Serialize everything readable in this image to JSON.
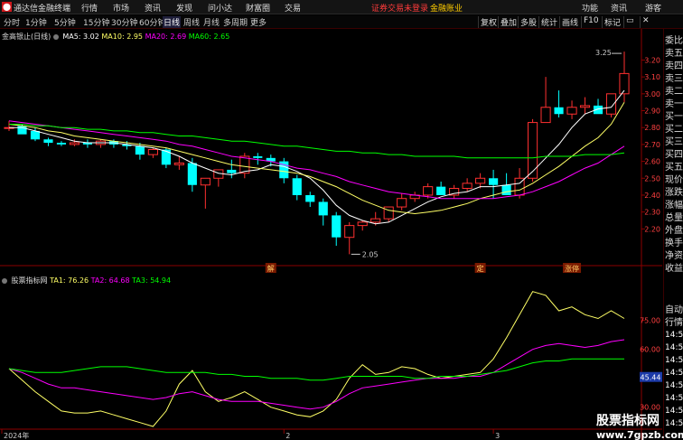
{
  "menubar": {
    "app_title": "通达信金融终端",
    "items": [
      "行情",
      "市场",
      "资讯",
      "发现",
      "问小达",
      "财富圈",
      "交易"
    ],
    "login_warning": "证券交易未登录",
    "login_extra": "金融账业",
    "right_items": [
      "功能",
      "资讯",
      "游客"
    ]
  },
  "toolbar": {
    "periods": [
      "分时",
      "1分钟",
      "5分钟",
      "15分钟",
      "30分钟",
      "60分钟",
      "日线",
      "周线",
      "月线",
      "多周期",
      "更多"
    ],
    "active_period": "日线",
    "tools": [
      "复权",
      "叠加",
      "多股",
      "统计",
      "画线",
      "F10",
      "标记"
    ]
  },
  "main_chart": {
    "title": "金高银止(日线)",
    "ma5_label": "MA5: 3.02",
    "ma10_label": "MA10: 2.95",
    "ma20_label": "MA20: 2.69",
    "ma60_label": "MA60: 2.65",
    "high_marker": "3.25",
    "low_marker": "2.05",
    "event_labels": [
      "解",
      "定",
      "涨停"
    ],
    "price_ticks": [
      "3.20",
      "3.10",
      "3.00",
      "2.90",
      "2.80",
      "2.70",
      "2.60",
      "2.50",
      "2.40",
      "2.30",
      "2.20"
    ]
  },
  "sub_chart": {
    "title": "股票指标网",
    "ta1_label": "TA1: 76.26",
    "ta2_label": "TA2: 64.68",
    "ta3_label": "TA3: 54.94",
    "value_ticks": [
      "75.00",
      "60.00",
      "45.00",
      "30.00"
    ],
    "current_badge": "45.44",
    "date_labels": [
      "2024年",
      "2",
      "3"
    ]
  },
  "side_panel": {
    "labels": [
      "委比",
      "卖五",
      "卖四",
      "卖三",
      "卖二",
      "卖一",
      "买一",
      "买二",
      "买三",
      "买四",
      "买五",
      "现价",
      "涨跌",
      "涨幅",
      "总量",
      "外盘",
      "换手",
      "净资",
      "收益",
      "自动",
      "行情"
    ],
    "times": [
      "14:56",
      "14:56",
      "14:56",
      "14:56",
      "14:56",
      "14:56",
      "14:56",
      "14:56"
    ]
  },
  "watermark": {
    "main": "股票指标网",
    "sub": "www.7gpzb.com"
  },
  "colors": {
    "up": "#ff3030",
    "down": "#00ffff",
    "ma5": "#ffffff",
    "ma10": "#ffff66",
    "ma20": "#ff00ff",
    "ma60": "#00ff00",
    "ta1": "#ffff66",
    "ta2": "#ff00ff",
    "ta3": "#00ff00"
  },
  "chart_data": [
    {
      "type": "candlestick",
      "title": "金高银止(日线)",
      "x_index": [
        0,
        1,
        2,
        3,
        4,
        5,
        6,
        7,
        8,
        9,
        10,
        11,
        12,
        13,
        14,
        15,
        16,
        17,
        18,
        19,
        20,
        21,
        22,
        23,
        24,
        25,
        26,
        27,
        28,
        29,
        30,
        31,
        32,
        33,
        34,
        35,
        36,
        37,
        38,
        39,
        40,
        41,
        42,
        43,
        44
      ],
      "open": [
        2.8,
        2.81,
        2.78,
        2.73,
        2.71,
        2.7,
        2.71,
        2.7,
        2.72,
        2.7,
        2.69,
        2.64,
        2.67,
        2.58,
        2.59,
        2.46,
        2.5,
        2.55,
        2.53,
        2.63,
        2.62,
        2.6,
        2.5,
        2.4,
        2.36,
        2.28,
        2.15,
        2.22,
        2.24,
        2.26,
        2.33,
        2.38,
        2.4,
        2.45,
        2.4,
        2.44,
        2.47,
        2.5,
        2.46,
        2.4,
        2.5,
        2.83,
        2.92,
        2.88,
        2.92,
        2.93,
        2.88,
        3.0
      ],
      "high": [
        2.84,
        2.82,
        2.8,
        2.74,
        2.72,
        2.73,
        2.73,
        2.73,
        2.73,
        2.72,
        2.71,
        2.68,
        2.68,
        2.63,
        2.62,
        2.5,
        2.55,
        2.61,
        2.65,
        2.65,
        2.64,
        2.62,
        2.52,
        2.42,
        2.38,
        2.3,
        2.24,
        2.25,
        2.3,
        2.33,
        2.41,
        2.42,
        2.47,
        2.48,
        2.46,
        2.5,
        2.53,
        2.55,
        2.53,
        2.56,
        2.85,
        3.1,
        3.02,
        2.96,
        2.98,
        2.97,
        2.96,
        3.25
      ],
      "low": [
        2.78,
        2.78,
        2.72,
        2.69,
        2.69,
        2.69,
        2.68,
        2.68,
        2.68,
        2.67,
        2.61,
        2.62,
        2.56,
        2.55,
        2.42,
        2.32,
        2.45,
        2.5,
        2.5,
        2.58,
        2.57,
        2.47,
        2.37,
        2.33,
        2.22,
        2.1,
        2.05,
        2.19,
        2.22,
        2.24,
        2.31,
        2.36,
        2.38,
        2.4,
        2.38,
        2.42,
        2.44,
        2.38,
        2.4,
        2.38,
        2.48,
        2.86,
        2.86,
        2.85,
        2.88,
        2.9,
        2.86,
        2.95
      ],
      "close": [
        2.8,
        2.76,
        2.73,
        2.71,
        2.7,
        2.71,
        2.7,
        2.72,
        2.7,
        2.69,
        2.64,
        2.67,
        2.58,
        2.59,
        2.46,
        2.5,
        2.55,
        2.53,
        2.63,
        2.62,
        2.6,
        2.5,
        2.4,
        2.36,
        2.28,
        2.15,
        2.22,
        2.24,
        2.26,
        2.33,
        2.38,
        2.4,
        2.45,
        2.4,
        2.44,
        2.47,
        2.5,
        2.46,
        2.4,
        2.5,
        2.83,
        2.92,
        2.88,
        2.92,
        2.93,
        2.88,
        3.0,
        3.12
      ],
      "ma5": [
        2.8,
        2.8,
        2.78,
        2.76,
        2.74,
        2.72,
        2.71,
        2.71,
        2.71,
        2.7,
        2.69,
        2.68,
        2.66,
        2.63,
        2.59,
        2.56,
        2.53,
        2.52,
        2.54,
        2.55,
        2.58,
        2.57,
        2.54,
        2.5,
        2.43,
        2.34,
        2.28,
        2.25,
        2.23,
        2.24,
        2.28,
        2.32,
        2.36,
        2.39,
        2.41,
        2.42,
        2.45,
        2.45,
        2.46,
        2.47,
        2.54,
        2.62,
        2.7,
        2.8,
        2.88,
        2.91,
        2.92,
        3.02
      ],
      "ma10": [
        2.82,
        2.81,
        2.8,
        2.78,
        2.77,
        2.75,
        2.74,
        2.73,
        2.72,
        2.71,
        2.7,
        2.69,
        2.68,
        2.66,
        2.64,
        2.62,
        2.6,
        2.58,
        2.57,
        2.56,
        2.55,
        2.54,
        2.53,
        2.51,
        2.48,
        2.45,
        2.41,
        2.37,
        2.34,
        2.31,
        2.3,
        2.29,
        2.3,
        2.31,
        2.33,
        2.35,
        2.38,
        2.4,
        2.42,
        2.43,
        2.47,
        2.52,
        2.57,
        2.63,
        2.69,
        2.74,
        2.82,
        2.95
      ],
      "ma20": [
        2.84,
        2.83,
        2.82,
        2.81,
        2.8,
        2.79,
        2.78,
        2.77,
        2.76,
        2.75,
        2.74,
        2.73,
        2.72,
        2.7,
        2.69,
        2.67,
        2.65,
        2.63,
        2.62,
        2.61,
        2.6,
        2.58,
        2.56,
        2.55,
        2.53,
        2.51,
        2.48,
        2.46,
        2.44,
        2.42,
        2.41,
        2.4,
        2.39,
        2.38,
        2.38,
        2.38,
        2.38,
        2.38,
        2.39,
        2.4,
        2.42,
        2.45,
        2.48,
        2.52,
        2.56,
        2.59,
        2.64,
        2.69
      ],
      "ma60": [
        2.82,
        2.82,
        2.81,
        2.81,
        2.8,
        2.8,
        2.79,
        2.79,
        2.78,
        2.78,
        2.77,
        2.77,
        2.76,
        2.75,
        2.75,
        2.74,
        2.73,
        2.72,
        2.72,
        2.71,
        2.7,
        2.69,
        2.69,
        2.68,
        2.67,
        2.66,
        2.66,
        2.65,
        2.65,
        2.64,
        2.64,
        2.63,
        2.63,
        2.63,
        2.63,
        2.62,
        2.62,
        2.62,
        2.62,
        2.62,
        2.62,
        2.63,
        2.63,
        2.63,
        2.64,
        2.64,
        2.64,
        2.65
      ],
      "ylim": [
        2.02,
        3.32
      ],
      "grid": false
    },
    {
      "type": "line",
      "title": "股票指标网",
      "series": [
        {
          "name": "TA1",
          "values": [
            50,
            44,
            38,
            33,
            28,
            27,
            27,
            28,
            26,
            24,
            22,
            20,
            28,
            42,
            49,
            38,
            33,
            35,
            38,
            34,
            30,
            28,
            26,
            25,
            28,
            34,
            45,
            52,
            47,
            48,
            51,
            50,
            47,
            45,
            46,
            47,
            48,
            55,
            66,
            78,
            90,
            88,
            80,
            82,
            78,
            76,
            80,
            76
          ]
        },
        {
          "name": "TA2",
          "values": [
            50,
            48,
            45,
            42,
            40,
            40,
            39,
            38,
            37,
            36,
            35,
            34,
            35,
            37,
            38,
            36,
            34,
            33,
            33,
            33,
            32,
            31,
            30,
            29,
            30,
            33,
            37,
            40,
            41,
            42,
            43,
            44,
            45,
            45,
            45,
            46,
            46,
            48,
            52,
            56,
            60,
            62,
            63,
            62,
            61,
            62,
            64,
            65
          ]
        },
        {
          "name": "TA3",
          "values": [
            50,
            49,
            48,
            48,
            48,
            49,
            50,
            51,
            51,
            51,
            50,
            49,
            48,
            48,
            48,
            48,
            47,
            47,
            46,
            46,
            45,
            45,
            45,
            44,
            44,
            45,
            46,
            46,
            46,
            46,
            46,
            45,
            45,
            46,
            46,
            46,
            47,
            48,
            49,
            51,
            53,
            54,
            54,
            55,
            55,
            55,
            55,
            55
          ]
        }
      ],
      "ylim": [
        20,
        95
      ],
      "grid": false
    }
  ]
}
